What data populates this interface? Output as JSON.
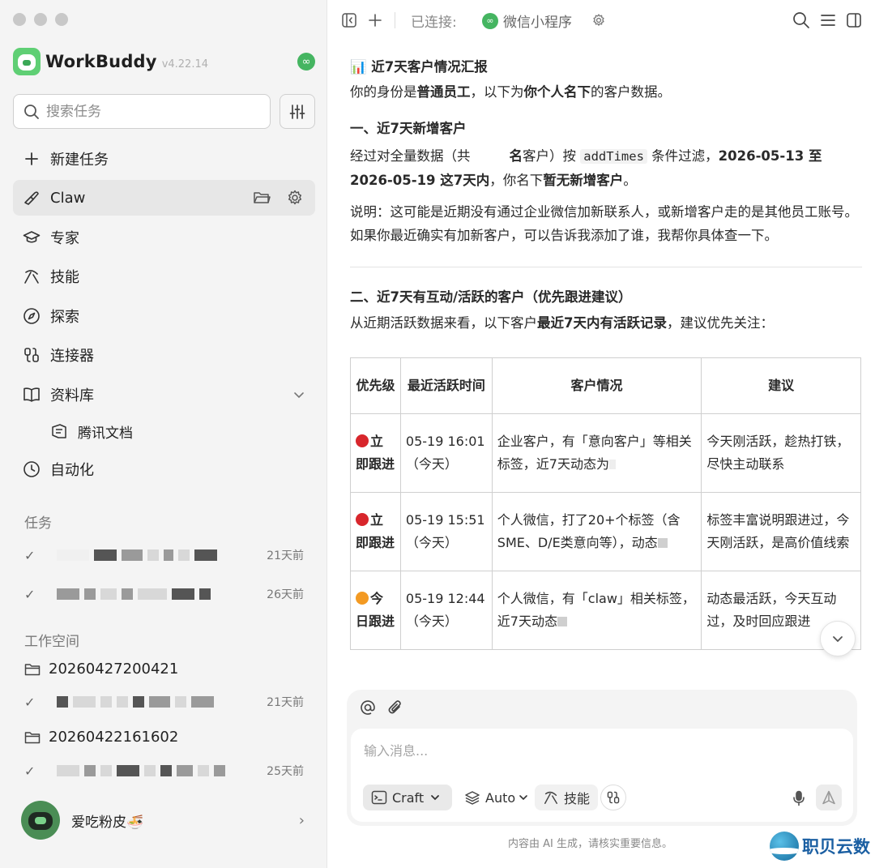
{
  "app": {
    "name": "WorkBuddy",
    "version": "v4.22.14"
  },
  "sidebar": {
    "search_placeholder": "搜索任务",
    "nav": [
      {
        "label": "新建任务",
        "icon": "plus-icon"
      },
      {
        "label": "Claw",
        "icon": "claw-icon"
      },
      {
        "label": "专家",
        "icon": "graduation-cap-icon"
      },
      {
        "label": "技能",
        "icon": "pickaxe-icon"
      },
      {
        "label": "探索",
        "icon": "compass-icon"
      },
      {
        "label": "连接器",
        "icon": "connector-icon"
      },
      {
        "label": "资料库",
        "icon": "book-icon"
      },
      {
        "label": "腾讯文档",
        "icon": "document-icon"
      },
      {
        "label": "自动化",
        "icon": "clock-icon"
      }
    ],
    "tasks_label": "任务",
    "tasks": [
      {
        "ago": "21天前"
      },
      {
        "ago": "26天前"
      }
    ],
    "workspace_label": "工作空间",
    "workspaces": [
      {
        "name": "20260427200421",
        "task_ago": "21天前"
      },
      {
        "name": "20260422161602",
        "task_ago": "25天前"
      }
    ],
    "user": {
      "name": "爱吃粉皮🍜"
    }
  },
  "topbar": {
    "connected_label": "已连接:",
    "mini_program": "微信小程序"
  },
  "message": {
    "title": "📊 近7天客户情况汇报",
    "intro_pre": "你的身份是",
    "intro_b1": "普通员工",
    "intro_mid": "，以下为",
    "intro_b2": "你个人名下",
    "intro_post": "的客户数据。",
    "s1_title": "一、近7天新增客户",
    "s1_p_pre": "经过对全量数据（共",
    "s1_p_b1": "名",
    "s1_p_mid1": "客户）按 ",
    "s1_code": "addTimes",
    "s1_p_mid2": " 条件过滤，",
    "s1_p_b2": "2026-05-13 至 2026-05-19 这7天内",
    "s1_p_mid3": "，你名下",
    "s1_p_b3": "暂无新增客户",
    "s1_p_end": "。",
    "s1_note": "说明：这可能是近期没有通过企业微信加新联系人，或新增客户走的是其他员工账号。如果你最近确实有加新客户，可以告诉我添加了谁，我帮你具体查一下。",
    "s2_title": "二、近7天有互动/活跃的客户（优先跟进建议）",
    "s2_p_pre": "从近期活跃数据来看，以下客户",
    "s2_p_b": "最近7天内有活跃记录",
    "s2_p_post": "，建议优先关注：",
    "table": {
      "headers": [
        "优先级",
        "最近活跃时间",
        "客户情况",
        "建议"
      ],
      "rows": [
        {
          "priority": "立即跟进",
          "dot": "#d8262c",
          "time": "05-19 16:01（今天）",
          "situation": "企业客户，有「意向客户」等相关标签，近7天动态为",
          "advice": "今天刚活跃，趁热打铁，尽快主动联系"
        },
        {
          "priority": "立即跟进",
          "dot": "#d8262c",
          "time": "05-19 15:51（今天）",
          "situation": "个人微信，打了20+个标签（含SME、D/E类意向等），动态",
          "advice": "标签丰富说明跟进过，今天刚活跃，是高价值线索"
        },
        {
          "priority": "今日跟进",
          "dot": "#f39a23",
          "time": "05-19 12:44（今天）",
          "situation": "个人微信，有「claw」相关标签，近7天动态",
          "advice": "动态最活跃，今天互动过，及时回应跟进"
        }
      ]
    }
  },
  "composer": {
    "placeholder": "输入消息...",
    "mode": "Craft",
    "model": "Auto",
    "skill": "技能"
  },
  "footer_note": "内容由 AI 生成，请核实重要信息。",
  "watermark": "职贝云数",
  "colors": {
    "accent_green": "#45b561",
    "red": "#d8262c",
    "orange": "#f39a23"
  }
}
